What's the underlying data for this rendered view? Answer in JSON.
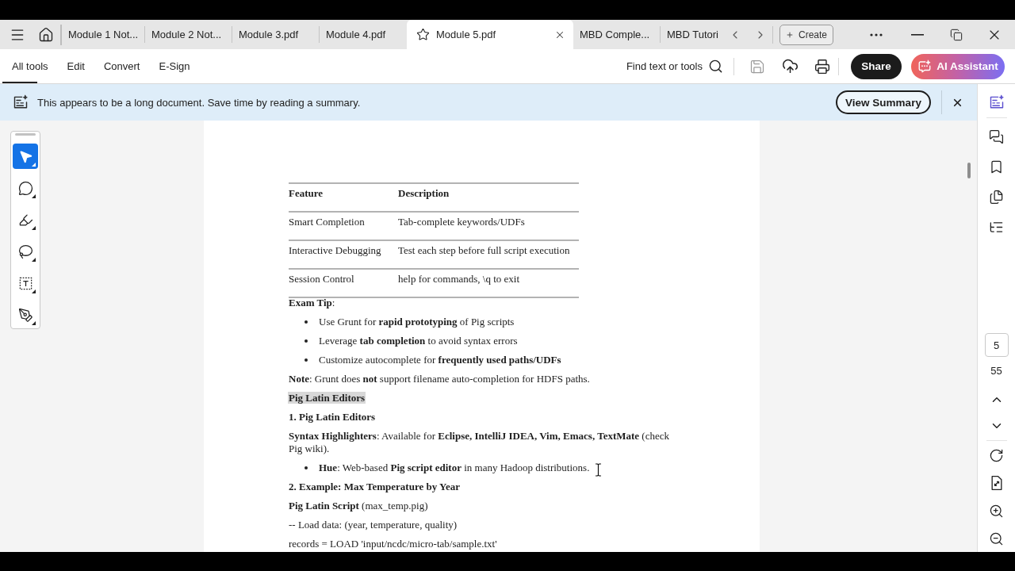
{
  "tab_bar": {
    "tabs": [
      {
        "label": "Module 1 Not...",
        "selected": false
      },
      {
        "label": "Module 2 Not...",
        "selected": false
      },
      {
        "label": "Module 3.pdf",
        "selected": false
      },
      {
        "label": "Module 4.pdf",
        "selected": false
      },
      {
        "label": "Module 5.pdf",
        "selected": true
      },
      {
        "label": "MBD Comple...",
        "selected": false
      },
      {
        "label": "MBD Tutori",
        "selected": false
      }
    ],
    "create_button": "Create"
  },
  "toolbar": {
    "menu": [
      {
        "label": "All tools",
        "selected": true
      },
      {
        "label": "Edit",
        "selected": false
      },
      {
        "label": "Convert",
        "selected": false
      },
      {
        "label": "E-Sign",
        "selected": false
      }
    ],
    "search_label": "Find text or tools",
    "save_disabled": true,
    "share_button": "Share",
    "ai_button": "AI Assistant"
  },
  "banner": {
    "message": "This appears to be a long document. Save time by reading a summary.",
    "button": "View Summary"
  },
  "tool_panel": {
    "tools": [
      {
        "kind": "select",
        "selected": true
      },
      {
        "kind": "comment",
        "selected": false
      },
      {
        "kind": "highlight",
        "selected": false
      },
      {
        "kind": "draw",
        "selected": false
      },
      {
        "kind": "text",
        "selected": false
      },
      {
        "kind": "sign",
        "selected": false
      }
    ]
  },
  "document": {
    "table": {
      "columns": [
        "Feature",
        "Description"
      ],
      "rows": [
        [
          "Smart Completion",
          "Tab-complete keywords/UDFs"
        ],
        [
          "Interactive Debugging",
          "Test each step before full script execution"
        ],
        [
          "Session Control",
          "help for commands, \\q to exit"
        ]
      ]
    },
    "blocks": [
      {
        "kind": "paragraph",
        "text": "**Exam Tip**:"
      },
      {
        "kind": "bullet",
        "text": "Use Grunt for **rapid prototyping** of Pig scripts"
      },
      {
        "kind": "bullet",
        "text": "Leverage **tab completion** to avoid syntax errors"
      },
      {
        "kind": "bullet",
        "text": "Customize autocomplete for **frequently used paths/UDFs**"
      },
      {
        "kind": "paragraph",
        "text": "**Note**: Grunt does **not** support filename auto-completion for HDFS paths."
      },
      {
        "kind": "heading",
        "text": "Pig Latin Editors",
        "highlighted": true
      },
      {
        "kind": "heading",
        "text": "1. Pig Latin Editors",
        "highlighted": false
      },
      {
        "kind": "paragraph",
        "text": "**Syntax Highlighters**: Available for **Eclipse, IntelliJ IDEA, Vim, Emacs, TextMate** (check Pig wiki)."
      },
      {
        "kind": "bullet",
        "text": "**Hue**: Web-based **Pig script editor** in many Hadoop distributions."
      },
      {
        "kind": "heading",
        "text": "2. Example: Max Temperature by Year",
        "highlighted": false
      },
      {
        "kind": "paragraph",
        "text": "**Pig Latin Script** (max_temp.pig)"
      },
      {
        "kind": "paragraph",
        "text": "-- Load data: (year, temperature, quality)"
      },
      {
        "kind": "paragraph",
        "text": "records = LOAD 'input/ncdc/micro-tab/sample.txt'"
      }
    ]
  },
  "page_nav": {
    "current_page": "5",
    "page_count": "55"
  }
}
